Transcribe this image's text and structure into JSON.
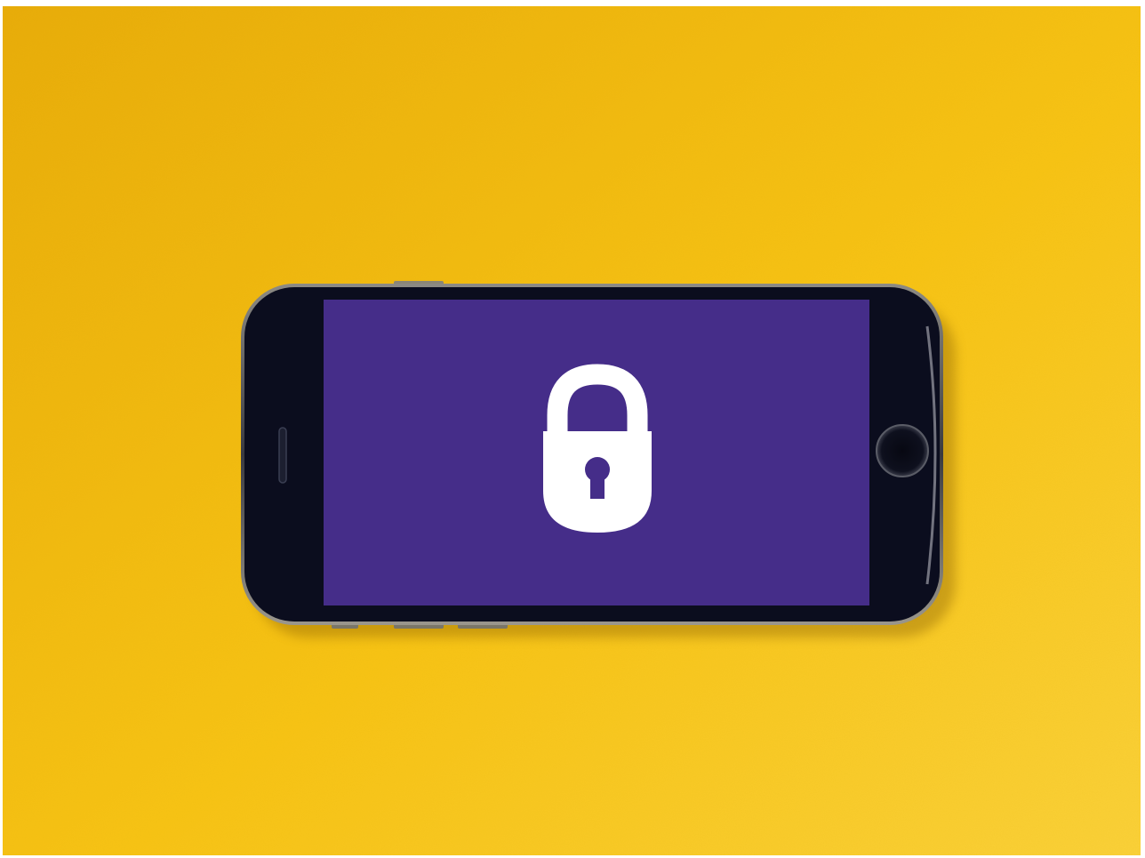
{
  "scene": {
    "background_color": "#F8C315",
    "background_highlight": "#FBD13A",
    "background_shadow": "#E9AC0A",
    "phone_body_color": "#0B0D1E",
    "phone_edge_color": "#6E6E72",
    "screen_color": "#452D89",
    "lock_color": "#FFFFFF",
    "icons": [
      "padlock-icon",
      "home-button",
      "earpiece-speaker"
    ]
  }
}
